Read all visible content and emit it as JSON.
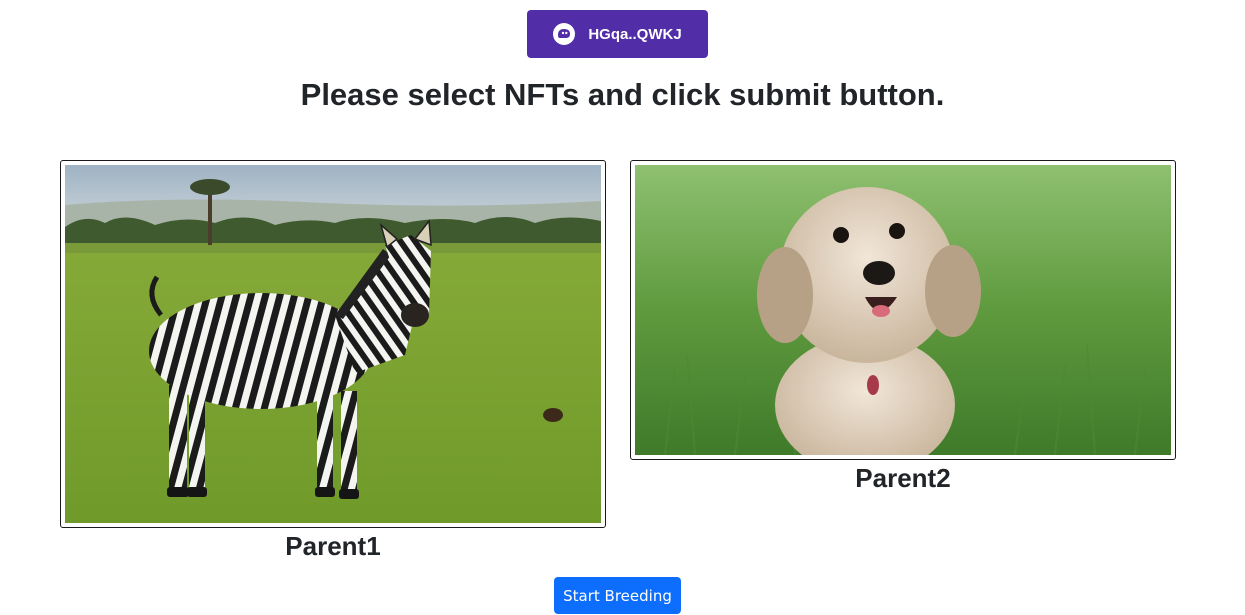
{
  "wallet": {
    "address_label": "HGqa..QWKJ",
    "icon": "phantom-ghost-icon",
    "color": "#512da8"
  },
  "page": {
    "title": "Please select NFTs and click submit button."
  },
  "nfts": [
    {
      "label": "Parent1",
      "image": "zebra-photo"
    },
    {
      "label": "Parent2",
      "image": "dog-photo"
    }
  ],
  "actions": {
    "start_label": "Start Breeding",
    "start_color": "#0d6efd"
  }
}
